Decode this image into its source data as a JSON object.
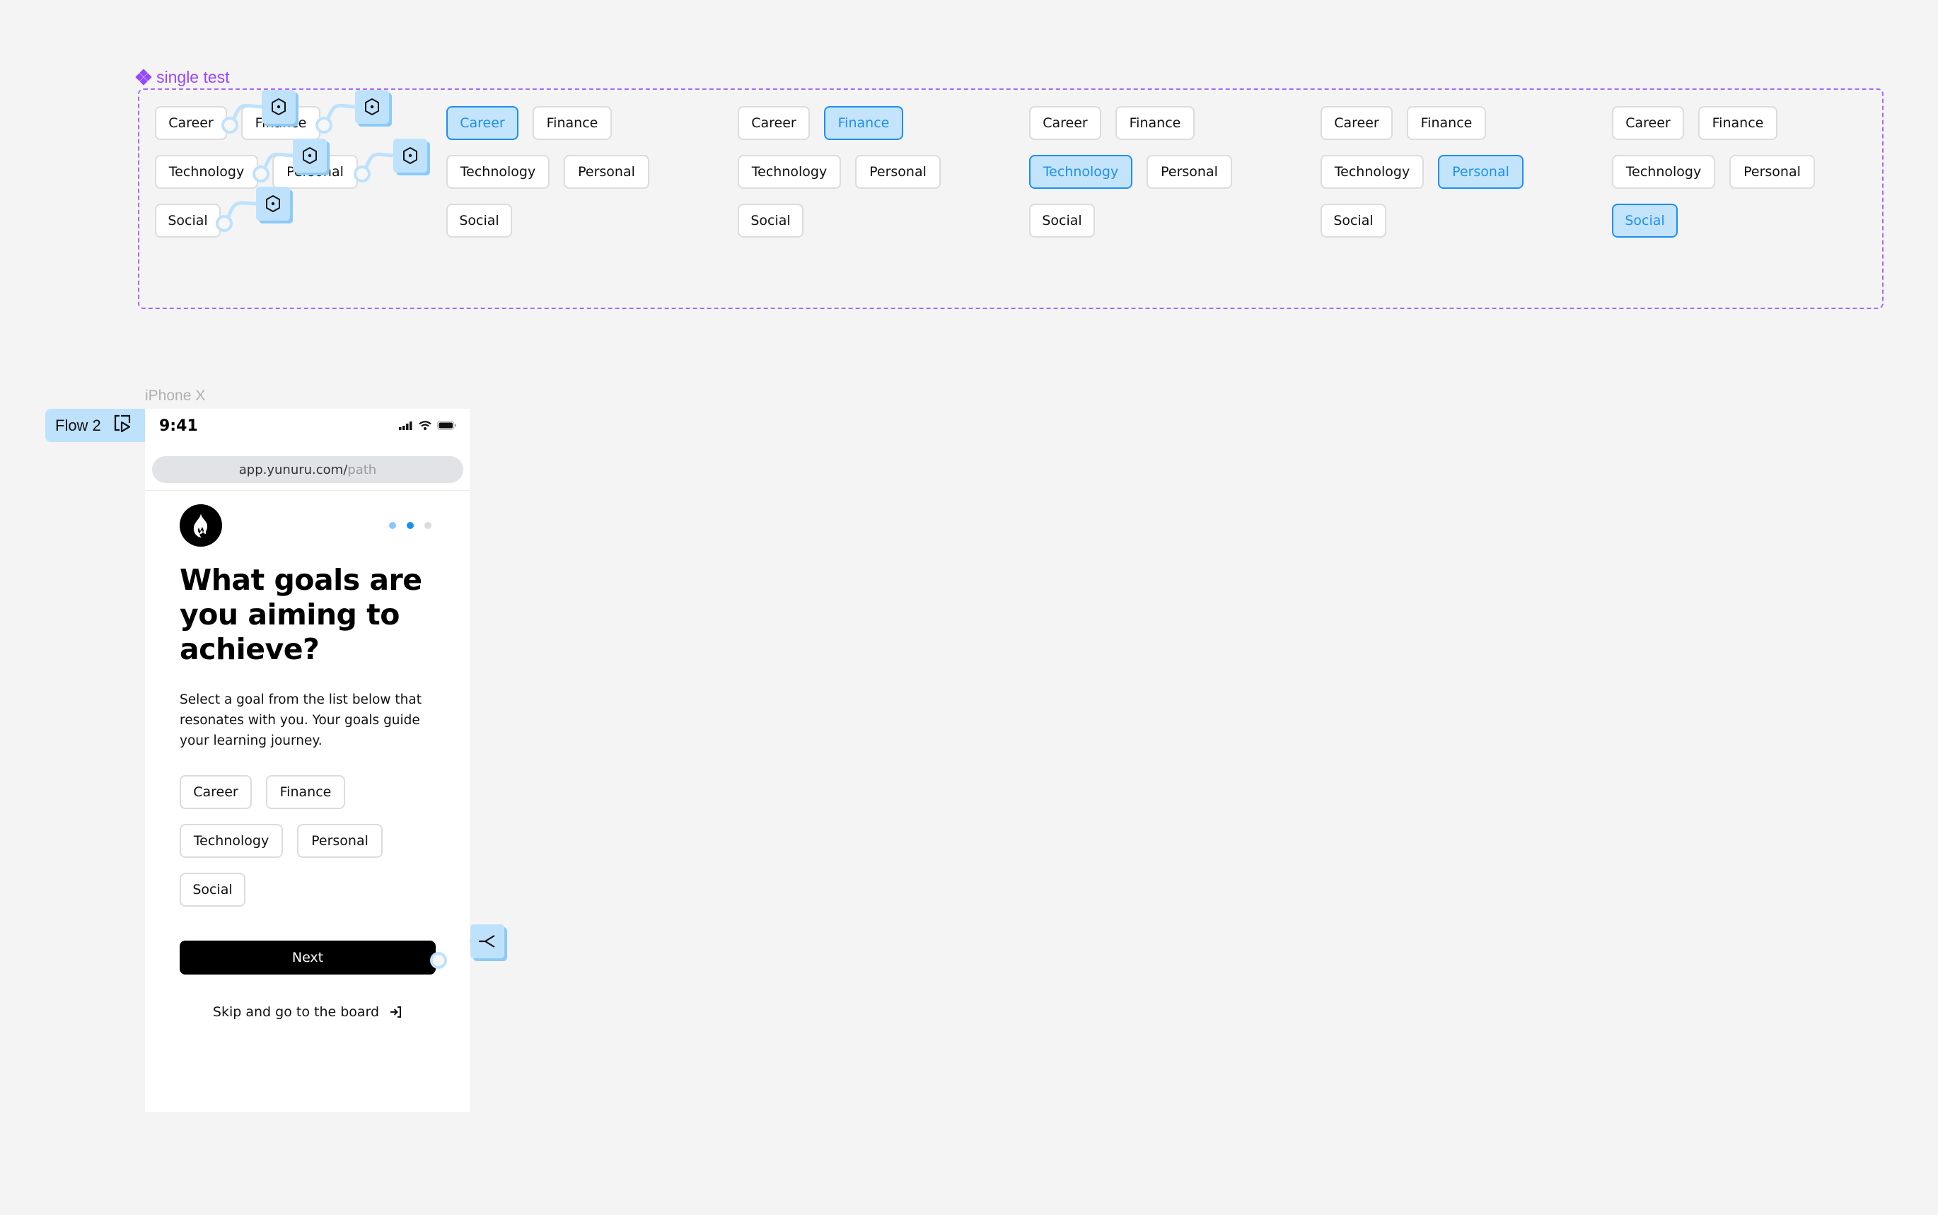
{
  "canvas": {
    "component_set": {
      "name": "single test",
      "variants": [
        {
          "selected": null,
          "chips": [
            "Career",
            "Finance",
            "Technology",
            "Personal",
            "Social"
          ]
        },
        {
          "selected": "Career",
          "chips": [
            "Career",
            "Finance",
            "Technology",
            "Personal",
            "Social"
          ]
        },
        {
          "selected": "Finance",
          "chips": [
            "Career",
            "Finance",
            "Technology",
            "Personal",
            "Social"
          ]
        },
        {
          "selected": "Technology",
          "chips": [
            "Career",
            "Finance",
            "Technology",
            "Personal",
            "Social"
          ]
        },
        {
          "selected": "Personal",
          "chips": [
            "Career",
            "Finance",
            "Technology",
            "Personal",
            "Social"
          ]
        },
        {
          "selected": "Social",
          "chips": [
            "Career",
            "Finance",
            "Technology",
            "Personal",
            "Social"
          ]
        }
      ],
      "interaction_icon": "component-hexagon-icon"
    },
    "flow": {
      "label": "Flow 2",
      "icon": "play-flow-icon"
    },
    "device_name": "iPhone X"
  },
  "phone": {
    "status_bar": {
      "time": "9:41",
      "icons": [
        "cellular-signal-icon",
        "wifi-icon",
        "battery-icon"
      ]
    },
    "url_bar": {
      "domain": "app.yunuru.com/",
      "path": "path"
    },
    "logo_icon": "flame-icon",
    "progress": {
      "total_steps": 3,
      "current_step": 2
    },
    "heading": "What goals are you aiming to achieve?",
    "subtitle": "Select a goal from the list below that resonates with you. Your goals guide your learning journey.",
    "goals": [
      "Career",
      "Finance",
      "Technology",
      "Personal",
      "Social"
    ],
    "next_label": "Next",
    "next_interaction_icon": "branch-icon",
    "skip_label": "Skip and go to the board",
    "skip_icon": "sign-in-arrow-icon"
  },
  "colors": {
    "background": "#f4f4f4",
    "component_purple": "#9747ff",
    "selected_fill": "#c4e4fb",
    "selected_accent": "#1d8ff0",
    "chip_border": "#dcdcdc",
    "prototype_blue": "#bfe2fc",
    "dot_past": "#8ac8fb",
    "dot_current": "#1d8ff0",
    "dot_future": "#dcdcdc"
  }
}
